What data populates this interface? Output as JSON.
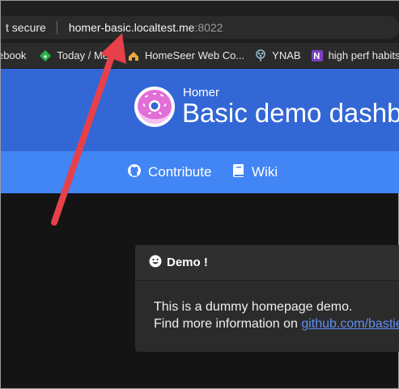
{
  "browser": {
    "security_label": "t secure",
    "url_host": "homer-basic.localtest.me",
    "url_port": ":8022"
  },
  "bookmarks": [
    {
      "label": "ebook",
      "icon": "bookmark-icon"
    },
    {
      "label": "Today / Me...",
      "icon": "feedly-icon"
    },
    {
      "label": "HomeSeer Web Co...",
      "icon": "homeseer-icon"
    },
    {
      "label": "YNAB",
      "icon": "ynab-tree-icon"
    },
    {
      "label": "high perf habits",
      "icon": "onenote-icon"
    }
  ],
  "header": {
    "subtitle": "Homer",
    "title": "Basic demo dashboard"
  },
  "navbar": {
    "contribute": "Contribute",
    "wiki": "Wiki"
  },
  "card": {
    "title": "Demo !",
    "line1": "This is a dummy homepage demo.",
    "line2_prefix": "Find more information on ",
    "line2_link": "github.com/bastienwirtz/homer"
  },
  "colors": {
    "hero": "#3367d6",
    "navbar": "#4285f4",
    "arrow": "#e8404a"
  }
}
